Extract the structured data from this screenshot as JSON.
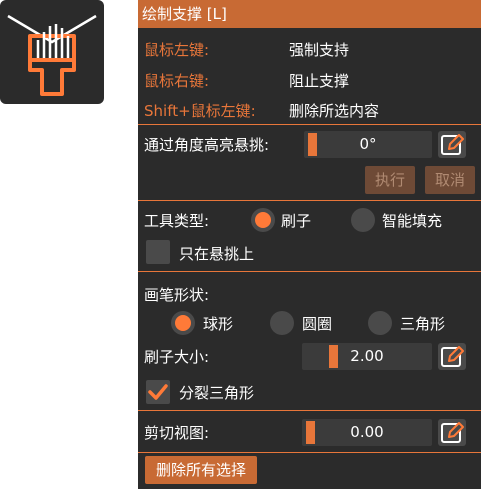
{
  "window": {
    "title": "绘制支撑 [L]"
  },
  "icon": "brush-icon",
  "colors": {
    "accent": "#e8763a",
    "title_bg": "#c86a34",
    "panel_bg": "#2b2b2b"
  },
  "shortcuts": [
    {
      "key": "鼠标左键:",
      "action": "强制支持"
    },
    {
      "key": "鼠标右键:",
      "action": "阻止支撑"
    },
    {
      "key": "Shift+鼠标左键:",
      "action": "删除所选内容"
    }
  ],
  "overhang": {
    "label": "通过角度高亮悬挑:",
    "value": "0°",
    "execute": "执行",
    "cancel": "取消"
  },
  "tool_type": {
    "label": "工具类型:",
    "options": [
      "刷子",
      "智能填充"
    ],
    "selected": "刷子"
  },
  "overhang_only": {
    "label": "只在悬挑上",
    "checked": false
  },
  "brush_shape": {
    "label": "画笔形状:",
    "options": [
      "球形",
      "圆圈",
      "三角形"
    ],
    "selected": "球形"
  },
  "brush_size": {
    "label": "刷子大小:",
    "value": "2.00"
  },
  "split_triangles": {
    "label": "分裂三角形",
    "checked": true
  },
  "clipping": {
    "label": "剪切视图:",
    "value": "0.00"
  },
  "clear_button": "删除所有选择"
}
